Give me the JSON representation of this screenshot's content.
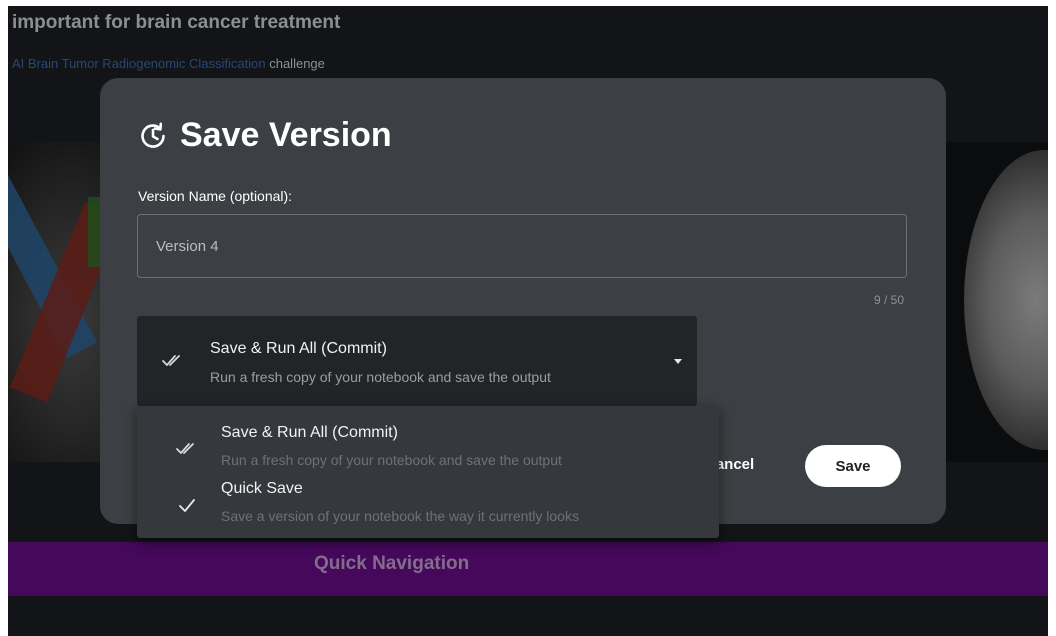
{
  "background": {
    "heading": "important for brain cancer treatment",
    "link_text": "AI Brain Tumor Radiogenomic Classification",
    "link_suffix": " challenge",
    "quick_nav_label": "Quick Navigation"
  },
  "modal": {
    "title": "Save Version",
    "title_icon": "history-icon",
    "field_label": "Version Name (optional):",
    "version_name_value": "Version 4",
    "char_count": "9 / 50",
    "selected_option": {
      "title": "Save & Run All (Commit)",
      "description": "Run a fresh copy of your notebook and save the output",
      "icon": "double-check-icon"
    },
    "cancel_label": "Cancel",
    "save_label": "Save"
  },
  "dropdown": {
    "options": [
      {
        "title": "Save & Run All (Commit)",
        "description": "Run a fresh copy of your notebook and save the output",
        "icon": "double-check-icon"
      },
      {
        "title": "Quick Save",
        "description": "Save a version of your notebook the way it currently looks",
        "icon": "check-icon"
      }
    ]
  },
  "colors": {
    "page_bg": "#1c2025",
    "modal_bg": "#3c3f43",
    "select_bg": "#222427",
    "menu_bg": "#35383c",
    "quick_nav_bg": "#6b0d8a",
    "link": "#3a6fb6"
  }
}
